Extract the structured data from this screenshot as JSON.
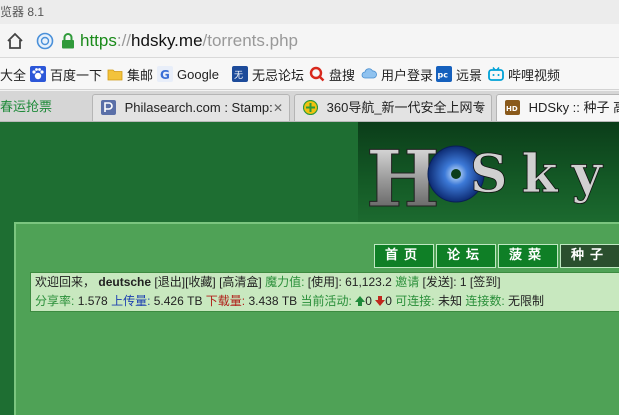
{
  "window": {
    "title": "览器 8.1"
  },
  "address": {
    "scheme": "https",
    "separator": "://",
    "host": "hdsky.me",
    "path": "/torrents.php"
  },
  "bookmarks": [
    {
      "label": "大全",
      "icon": "none"
    },
    {
      "label": "百度一下",
      "icon": "baidu-paw-icon"
    },
    {
      "label": "集邮",
      "icon": "folder-icon"
    },
    {
      "label": "Google",
      "icon": "google-icon"
    },
    {
      "label": "无忌论坛",
      "icon": "forum-icon"
    },
    {
      "label": "盘搜",
      "icon": "search-q-icon"
    },
    {
      "label": "用户登录",
      "icon": "cloud-icon"
    },
    {
      "label": "远景",
      "icon": "pc-icon"
    },
    {
      "label": "哔哩视频",
      "icon": "bilibili-tv-icon"
    }
  ],
  "tabs": [
    {
      "label": "春运抢票"
    },
    {
      "label": "Philasearch.com : Stamp:"
    },
    {
      "label": "360导航_新一代安全上网专"
    },
    {
      "label": "HDSky :: 种子 高清"
    }
  ],
  "site": {
    "logo_text": "HD Sky",
    "nav": [
      "首页",
      "论坛",
      "菠菜",
      "种子"
    ],
    "user": {
      "welcome": "欢迎回来，",
      "username": "deutsche",
      "logout": "[退出]",
      "favorites": "[收藏]",
      "hdbox": "[高清盒]",
      "magic_label": "魔力值:",
      "magic_use": "[使用]",
      "magic_value": ": 61,123.2",
      "invite_label": "邀请",
      "invite_send": "[发送]",
      "invite_value": ": 1",
      "signin": "[签到]"
    },
    "stats": {
      "ratio_label": "分享率:",
      "ratio_value": "1.578",
      "upload_label": "上传量:",
      "upload_value": "5.426 TB",
      "download_label": "下载量:",
      "download_value": "3.438 TB",
      "active_label": "当前活动:",
      "seeding": "0",
      "leeching": "0",
      "connectable_label": "可连接:",
      "connectable_value": "未知",
      "connections_label": "连接数:",
      "connections_value": "无限制"
    }
  }
}
